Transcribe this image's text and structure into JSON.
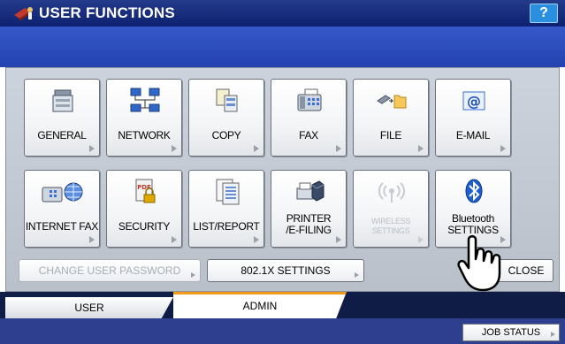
{
  "header": {
    "title": "USER FUNCTIONS",
    "help_label": "?"
  },
  "functions": [
    {
      "label": "GENERAL",
      "icon": "general-copier-icon"
    },
    {
      "label": "NETWORK",
      "icon": "network-computers-icon"
    },
    {
      "label": "COPY",
      "icon": "copy-documents-icon"
    },
    {
      "label": "FAX",
      "icon": "fax-machine-icon"
    },
    {
      "label": "FILE",
      "icon": "file-folder-icon"
    },
    {
      "label": "E-MAIL",
      "icon": "email-at-icon"
    },
    {
      "label": "INTERNET FAX",
      "icon": "internet-fax-globe-icon"
    },
    {
      "label": "SECURITY",
      "icon": "pdf-lock-icon"
    },
    {
      "label": "LIST/REPORT",
      "icon": "list-report-icon"
    },
    {
      "label_line1": "PRINTER",
      "label_line2": "/E-FILING",
      "icon": "printer-box-icon"
    },
    {
      "label_line1": "WIRELESS",
      "label_line2": "SETTINGS",
      "icon": "wireless-antenna-icon",
      "disabled": true
    },
    {
      "label_line1": "Bluetooth",
      "label_line2": "SETTINGS",
      "icon": "bluetooth-icon"
    }
  ],
  "actions": {
    "change_password": "CHANGE USER PASSWORD",
    "dot1x": "802.1X SETTINGS",
    "close": "CLOSE"
  },
  "tabs": {
    "user": "USER",
    "admin": "ADMIN"
  },
  "footer": {
    "job_status": "JOB STATUS"
  }
}
